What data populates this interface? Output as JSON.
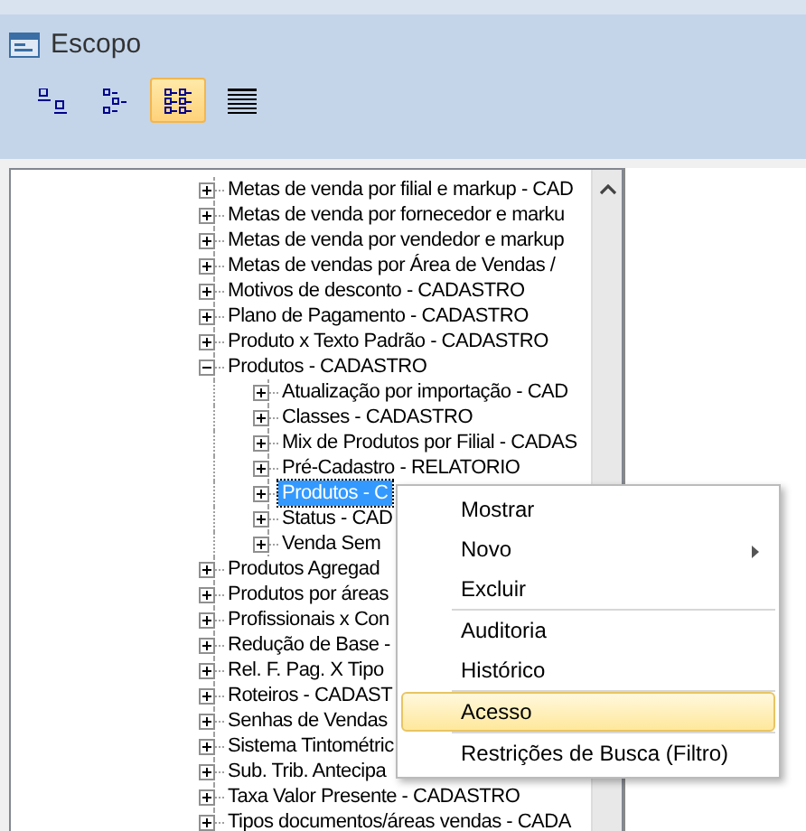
{
  "window": {
    "title": "Escopo"
  },
  "view_buttons": [
    {
      "kind": "small-icons",
      "selected": false
    },
    {
      "kind": "list",
      "selected": false
    },
    {
      "kind": "tree",
      "selected": true
    },
    {
      "kind": "details",
      "selected": false
    }
  ],
  "tree": [
    {
      "label": "Metas de venda por filial e markup - CAD",
      "expanded": false,
      "selected": false
    },
    {
      "label": "Metas de venda por fornecedor e marku",
      "expanded": false,
      "selected": false
    },
    {
      "label": "Metas de venda por vendedor e markup",
      "expanded": false,
      "selected": false
    },
    {
      "label": "Metas de vendas por Área de Vendas /",
      "expanded": false,
      "selected": false
    },
    {
      "label": "Motivos de desconto - CADASTRO",
      "expanded": false,
      "selected": false
    },
    {
      "label": "Plano de Pagamento - CADASTRO",
      "expanded": false,
      "selected": false
    },
    {
      "label": "Produto x Texto Padrão - CADASTRO",
      "expanded": false,
      "selected": false
    },
    {
      "label": "Produtos - CADASTRO",
      "expanded": true,
      "selected": false,
      "children": [
        {
          "label": "Atualização por importação - CAD",
          "expanded": false,
          "selected": false
        },
        {
          "label": "Classes - CADASTRO",
          "expanded": false,
          "selected": false
        },
        {
          "label": "Mix de Produtos por Filial - CADAS",
          "expanded": false,
          "selected": false
        },
        {
          "label": "Pré-Cadastro - RELATORIO",
          "expanded": false,
          "selected": false
        },
        {
          "label": "Produtos - C",
          "expanded": false,
          "selected": true
        },
        {
          "label": "Status - CAD",
          "expanded": false,
          "selected": false
        },
        {
          "label": "Venda Sem",
          "expanded": false,
          "selected": false
        }
      ]
    },
    {
      "label": "Produtos Agregad",
      "expanded": false,
      "selected": false
    },
    {
      "label": "Produtos por áreas",
      "expanded": false,
      "selected": false
    },
    {
      "label": "Profissionais x Con",
      "expanded": false,
      "selected": false
    },
    {
      "label": "Redução de Base -",
      "expanded": false,
      "selected": false
    },
    {
      "label": "Rel. F. Pag. X Tipo",
      "expanded": false,
      "selected": false
    },
    {
      "label": "Roteiros - CADAST",
      "expanded": false,
      "selected": false
    },
    {
      "label": "Senhas de Vendas",
      "expanded": false,
      "selected": false
    },
    {
      "label": "Sistema Tintométric",
      "expanded": false,
      "selected": false
    },
    {
      "label": "Sub. Trib. Antecipa",
      "expanded": false,
      "selected": false
    },
    {
      "label": "Taxa Valor Presente - CADASTRO",
      "expanded": false,
      "selected": false
    },
    {
      "label": "Tipos documentos/áreas vendas - CADA",
      "expanded": false,
      "selected": false
    }
  ],
  "context_menu": [
    {
      "label": "Mostrar",
      "selected": false,
      "has_submenu": false,
      "separator_before": false
    },
    {
      "label": "Novo",
      "selected": false,
      "has_submenu": true,
      "separator_before": false
    },
    {
      "label": "Excluir",
      "selected": false,
      "has_submenu": false,
      "separator_before": false
    },
    {
      "label": "Auditoria",
      "selected": false,
      "has_submenu": false,
      "separator_before": true
    },
    {
      "label": "Histórico",
      "selected": false,
      "has_submenu": false,
      "separator_before": false
    },
    {
      "label": "Acesso",
      "selected": true,
      "has_submenu": false,
      "separator_before": true
    },
    {
      "label": "Restrições de Busca (Filtro)",
      "selected": false,
      "has_submenu": false,
      "separator_before": true
    }
  ]
}
